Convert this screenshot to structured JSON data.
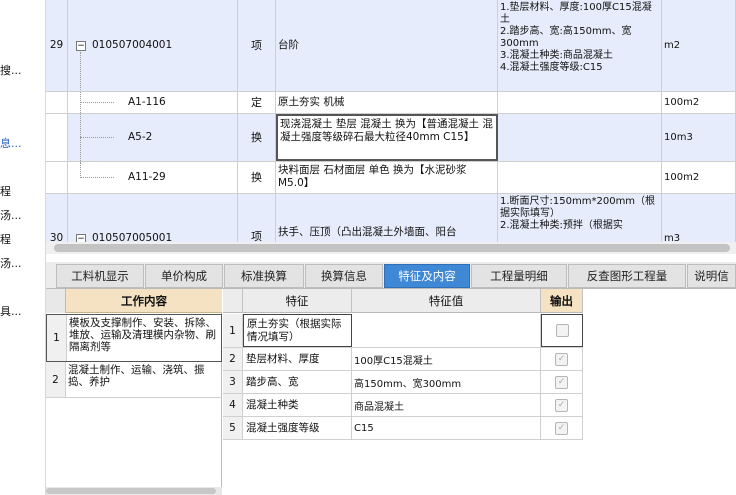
{
  "left_fragments": [
    "搜...",
    "息...",
    "程",
    "汤...",
    "程",
    "汤...",
    "具..."
  ],
  "main_grid": {
    "rows": [
      {
        "num": "29",
        "code": "010507004001",
        "type": "项",
        "name": "台阶",
        "feature": "1.垫层材料、厚度:100厚C15混凝土\n2.踏步高、宽:高150mm、宽300mm\n3.混凝土种类:商品混凝土\n4.混凝土强度等级:C15",
        "unit": "m2",
        "expandable": true
      },
      {
        "num": "",
        "code": "A1-116",
        "type": "定",
        "name": "原土夯实 机械",
        "feature": "",
        "unit": "100m2"
      },
      {
        "num": "",
        "code": "A5-2",
        "type": "换",
        "name": "现浇混凝土 垫层 混凝土   换为【普通混凝土 混凝土强度等级碎石最大粒径40mm C15】",
        "feature": "",
        "unit": "10m3"
      },
      {
        "num": "",
        "code": "A11-29",
        "type": "换",
        "name": "块料面层 石材面层 单色   换为【水泥砂浆M5.0】",
        "feature": "",
        "unit": "100m2"
      },
      {
        "num": "30",
        "code": "010507005001",
        "type": "项",
        "name": "扶手、压顶（凸出混凝土外墙面、阳台",
        "feature": "1.断面尺寸:150mm*200mm（根据实际填写）\n2.混凝土种类:预拌（根据实",
        "unit": "m3",
        "expandable": true
      }
    ]
  },
  "tabs": [
    {
      "label": "工料机显示",
      "active": false
    },
    {
      "label": "单价构成",
      "active": false
    },
    {
      "label": "标准换算",
      "active": false
    },
    {
      "label": "换算信息",
      "active": false
    },
    {
      "label": "特征及内容",
      "active": true
    },
    {
      "label": "工程量明细",
      "active": false
    },
    {
      "label": "反查图形工程量",
      "active": false
    },
    {
      "label": "说明信",
      "active": false
    }
  ],
  "work_content": {
    "header": "工作内容",
    "rows": [
      {
        "num": "1",
        "text": "模板及支撑制作、安装、拆除、堆放、运输及清理模内杂物、刷隔离剂等"
      },
      {
        "num": "2",
        "text": "混凝土制作、运输、浇筑、振捣、养护"
      }
    ]
  },
  "features": {
    "headers": {
      "feature": "特征",
      "value": "特征值",
      "output": "输出"
    },
    "rows": [
      {
        "num": "1",
        "name": "原土夯实（根据实际情况填写）",
        "value": "",
        "output": false
      },
      {
        "num": "2",
        "name": "垫层材料、厚度",
        "value": "100厚C15混凝土",
        "output": true
      },
      {
        "num": "3",
        "name": "踏步高、宽",
        "value": "高150mm、宽300mm",
        "output": true
      },
      {
        "num": "4",
        "name": "混凝土种类",
        "value": "商品混凝土",
        "output": true
      },
      {
        "num": "5",
        "name": "混凝土强度等级",
        "value": "C15",
        "output": true
      }
    ]
  },
  "colors": {
    "active_tab": "#3f88d6",
    "highlight_row": "#e6ecfb",
    "header_tan": "#f4e2c2"
  }
}
